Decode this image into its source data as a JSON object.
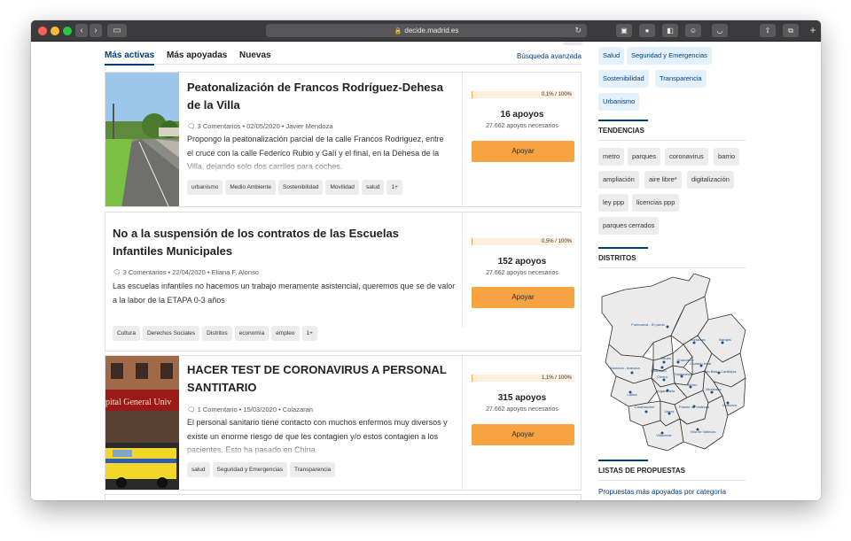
{
  "browser": {
    "url": "decide.madrid.es",
    "tab_count": "2"
  },
  "tabs": {
    "active": "Más activas",
    "most_supported": "Más apoyadas",
    "new": "Nuevas",
    "advanced_search": "Búsqueda avanzada"
  },
  "proposals": [
    {
      "title": "Peatonalización de Francos Rodríguez-Dehesa de la Villa",
      "comments": "3 Comentarios",
      "date": "02/05/2020",
      "author": "Javier Mendoza",
      "description": "Propongo la peatonalización parcial de la calle Francos Rodriguez, entre el cruce con la calle Federico Rubio y Galí y el final, en la Dehesa de la Villa, dejando solo dos carriles para coches.",
      "tags": [
        "urbanismo",
        "Medio Ambiente",
        "Sostenibilidad",
        "Movilidad",
        "salud",
        "1+"
      ],
      "progress_label": "0,1% / 100%",
      "progress": 0.1,
      "supports": "16 apoyos",
      "needed": "27.662 apoyos necesarios",
      "button": "Apoyar"
    },
    {
      "title": "No a la suspensión de los contratos de las Escuelas Infantiles Municipales",
      "comments": "3 Comentarios",
      "date": "22/04/2020",
      "author": "Eliana F. Alonso",
      "description": "Las escuelas infantiles no hacemos un trabajo meramente asistencial, queremos que se de valor a la labor de la ETAPA 0-3 años",
      "tags": [
        "Cultura",
        "Derechos Sociales",
        "Distritos",
        "economía",
        "empleo",
        "1+"
      ],
      "progress_label": "0,5% / 100%",
      "progress": 0.5,
      "supports": "152 apoyos",
      "needed": "27.662 apoyos necesarios",
      "button": "Apoyar"
    },
    {
      "title": "HACER TEST DE CORONAVIRUS A PERSONAL SANTITARIO",
      "comments": "1 Comentario",
      "date": "15/03/2020",
      "author": "Colazaran",
      "description": "El personal sanitario tiene contacto con muchos enfermos muy diversos y existe un enorme riesgo de que les contagien y/o estos contagien a los pacientes. Esto ha pasado en China.",
      "tags": [
        "salud",
        "Seguridad y Emergencias",
        "Transparencia"
      ],
      "progress_label": "1,1% / 100%",
      "progress": 1.1,
      "supports": "315 apoyos",
      "needed": "27.662 apoyos necesarios",
      "button": "Apoyar",
      "image_text": "pital General Univ"
    }
  ],
  "sidebar": {
    "category_tags": [
      "Salud",
      "Seguridad y Emergencias",
      "Sostenibilidad",
      "Transparencia",
      "Urbanismo"
    ],
    "trends_title": "TENDENCIAS",
    "trends": [
      "metro",
      "parques",
      "coronavirus",
      "barrio",
      "ampliación",
      "aire libre*",
      "digitalización",
      "ley ppp",
      "licencias ppp",
      "parques cerrados"
    ],
    "districts_title": "DISTRITOS",
    "districts": [
      "Fuencarral - El pardo",
      "Moncloa - Aravaca",
      "Tetuán",
      "Chamartín",
      "Hortaleza",
      "Barajas",
      "Chamberí",
      "Ciudad Lineal",
      "Salamanca",
      "San Blas - Canillejas",
      "Centro",
      "Retiro",
      "Latina",
      "Arganzuela",
      "Moratalaz",
      "Carabanchel",
      "Usera",
      "Puente de Vallecas",
      "Vicálvaro",
      "Villaverde",
      "Villa de Vallecas"
    ],
    "lists_title": "LISTAS DE PROPUESTAS",
    "lists_link": "Propuestas más apoyadas por categoría"
  }
}
